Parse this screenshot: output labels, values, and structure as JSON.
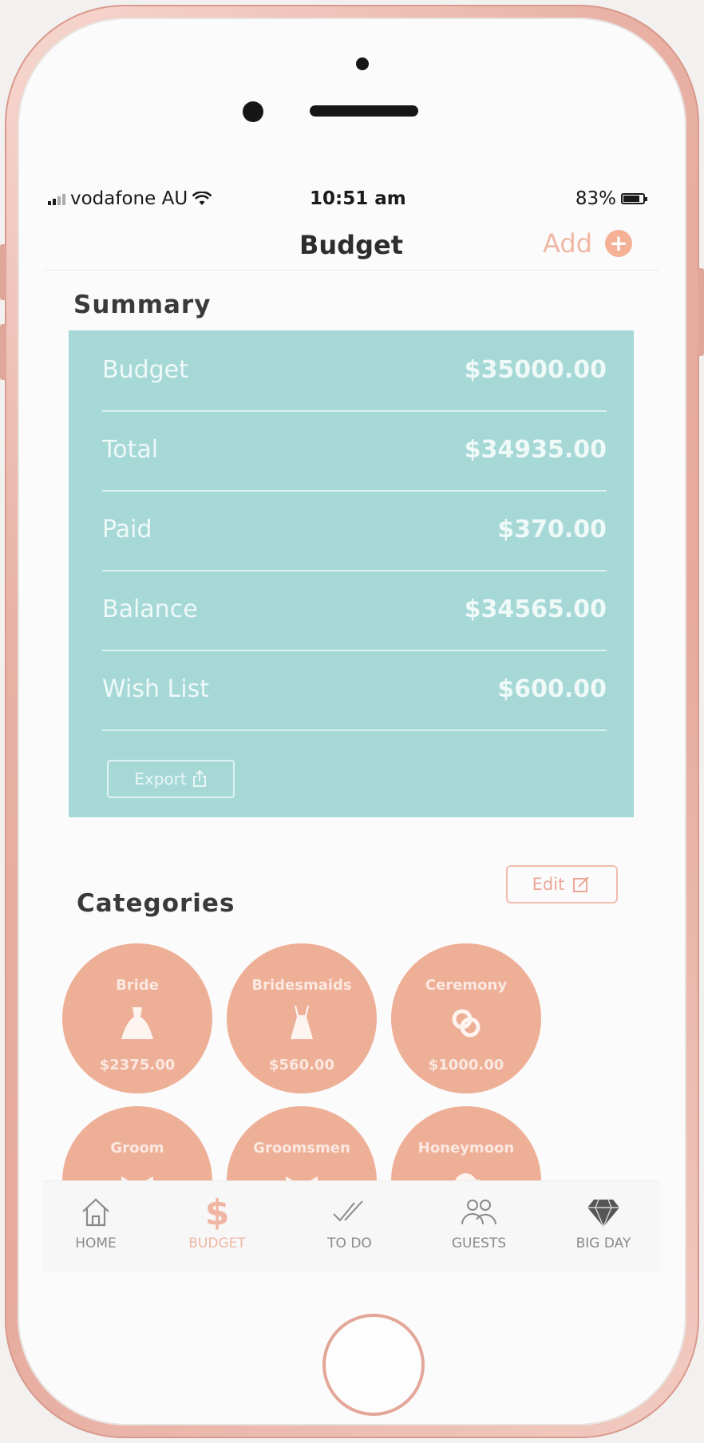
{
  "status": {
    "carrier": "vodafone AU",
    "time": "10:51 am",
    "battery": "83%"
  },
  "nav": {
    "title": "Budget",
    "add_label": "Add",
    "add_icon": "plus-circle-icon"
  },
  "summary": {
    "title": "Summary",
    "rows": [
      {
        "label": "Budget",
        "value": "$35000.00"
      },
      {
        "label": "Total",
        "value": "$34935.00"
      },
      {
        "label": "Paid",
        "value": "$370.00"
      },
      {
        "label": "Balance",
        "value": "$34565.00"
      },
      {
        "label": "Wish List",
        "value": "$600.00"
      }
    ],
    "export_label": "Export"
  },
  "categories": {
    "title": "Categories",
    "edit_label": "Edit",
    "items": [
      {
        "name": "Bride",
        "amount": "$2375.00",
        "icon": "dress-icon"
      },
      {
        "name": "Bridesmaids",
        "amount": "$560.00",
        "icon": "bridesmaid-dress-icon"
      },
      {
        "name": "Ceremony",
        "amount": "$1000.00",
        "icon": "rings-icon"
      },
      {
        "name": "Groom",
        "amount": "",
        "icon": "bowtie-icon"
      },
      {
        "name": "Groomsmen",
        "amount": "",
        "icon": "bowtie-icon"
      },
      {
        "name": "Honeymoon",
        "amount": "",
        "icon": "cloud-icon"
      }
    ]
  },
  "tabs": [
    {
      "label": "HOME",
      "icon": "home-icon"
    },
    {
      "label": "BUDGET",
      "icon": "dollar-icon",
      "active": true
    },
    {
      "label": "TO DO",
      "icon": "double-check-icon"
    },
    {
      "label": "GUESTS",
      "icon": "guests-icon"
    },
    {
      "label": "BIG DAY",
      "icon": "diamond-icon"
    }
  ],
  "colors": {
    "accent": "#eeaf97",
    "summary_bg": "#a6d8d6",
    "add_accent": "#f4b196"
  }
}
